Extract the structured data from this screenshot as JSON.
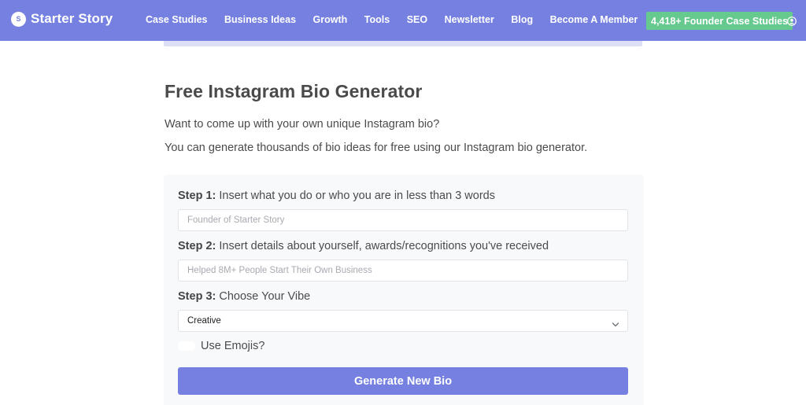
{
  "nav": {
    "brand": {
      "logo_letter": "S",
      "name": "Starter Story"
    },
    "links": [
      {
        "label": "Case Studies"
      },
      {
        "label": "Business Ideas"
      },
      {
        "label": "Growth"
      },
      {
        "label": "Tools"
      },
      {
        "label": "SEO"
      },
      {
        "label": "Newsletter"
      },
      {
        "label": "Blog"
      },
      {
        "label": "Become A Member"
      }
    ],
    "cta_label": "4,418+ Founder Case Studies",
    "user_icon": "user-circle-icon"
  },
  "main": {
    "title": "Free Instagram Bio Generator",
    "intro": [
      "Want to come up with your own unique Instagram bio?",
      "You can generate thousands of bio ideas for free using our Instagram bio generator."
    ]
  },
  "form": {
    "step1": {
      "prefix": "Step 1:",
      "text": " Insert what you do or who you are in less than 3 words",
      "value": "",
      "placeholder": "Founder of Starter Story"
    },
    "step2": {
      "prefix": "Step 2:",
      "text": " Insert details about yourself, awards/recognitions you've received",
      "value": "",
      "placeholder": "Helped 8M+ People Start Their Own Business"
    },
    "step3": {
      "prefix": "Step 3:",
      "text": " Choose Your Vibe",
      "selected": "Creative"
    },
    "emojis": {
      "label": "Use Emojis?",
      "checked": false
    },
    "generate_label": "Generate New Bio"
  },
  "colors": {
    "brand": "#7580e0",
    "cta": "#66c98e",
    "subbar": "#dcdff6",
    "card_bg": "#f8f9fb"
  }
}
